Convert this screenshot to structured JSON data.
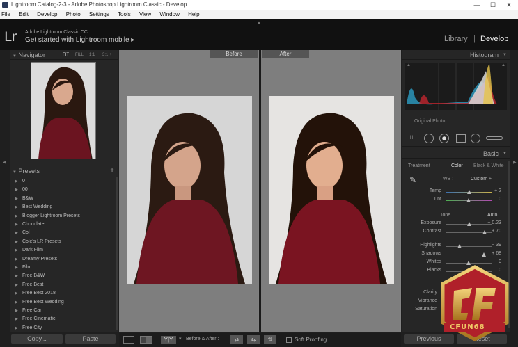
{
  "window": {
    "title": "Lightroom Catalog-2-3 - Adobe Photoshop Lightroom Classic - Develop",
    "min": "—",
    "max": "☐",
    "close": "✕"
  },
  "menu": [
    "File",
    "Edit",
    "Develop",
    "Photo",
    "Settings",
    "Tools",
    "View",
    "Window",
    "Help"
  ],
  "identity": {
    "logo": "Lr",
    "product": "Adobe Lightroom Classic CC",
    "tagline": "Get started with Lightroom mobile",
    "arrow": "▸"
  },
  "modules": {
    "library": "Library",
    "sep": "|",
    "develop": "Develop"
  },
  "navigator": {
    "title": "Navigator",
    "fit": "FIT",
    "fill": "FILL",
    "one": "1:1",
    "ratio": "3:1 ÷"
  },
  "presets": {
    "title": "Presets",
    "add": "+",
    "items": [
      "0",
      "00",
      "B&W",
      "Best Wedding",
      "Blogger Lightroom Presets",
      "Chocolate",
      "Col",
      "Cole's LR Presets",
      "Dark Film",
      "Dreamy Presets",
      "Film",
      "Free B&W",
      "Free Best",
      "Free Best 2018",
      "Free Best Wedding",
      "Free Car",
      "Free Cinematic",
      "Free City"
    ]
  },
  "left_buttons": {
    "copy": "Copy...",
    "paste": "Paste"
  },
  "views": {
    "before": "Before",
    "after": "After"
  },
  "toolbar": {
    "before_after": "Before & After :",
    "soft_proofing": "Soft Proofing",
    "yy": "Y|Y"
  },
  "histogram": {
    "title": "Histogram",
    "original": "Original Photo"
  },
  "basic": {
    "title": "Basic",
    "treatment": "Treatment :",
    "color": "Color",
    "bw": "Black & White",
    "wb": "WB :",
    "wb_value": "Custom ÷",
    "tone": "Tone",
    "auto": "Auto"
  },
  "sliders": [
    {
      "label": "Temp",
      "value": "+ 2",
      "pos": 0.52
    },
    {
      "label": "Tint",
      "value": "0",
      "pos": 0.5
    },
    {
      "label": "Exposure",
      "value": "+ 0.23",
      "pos": 0.52
    },
    {
      "label": "Contrast",
      "value": "+ 70",
      "pos": 0.85
    },
    {
      "label": "Highlights",
      "value": "− 39",
      "pos": 0.3
    },
    {
      "label": "Shadows",
      "value": "+ 68",
      "pos": 0.84
    },
    {
      "label": "Whites",
      "value": "0",
      "pos": 0.5
    },
    {
      "label": "Blacks",
      "value": "0",
      "pos": 0.5
    }
  ],
  "presence": [
    "Clarity",
    "Vibrance",
    "Saturation"
  ],
  "right_buttons": {
    "previous": "Previous",
    "reset": "Reset"
  },
  "watermark": "CFUN68"
}
